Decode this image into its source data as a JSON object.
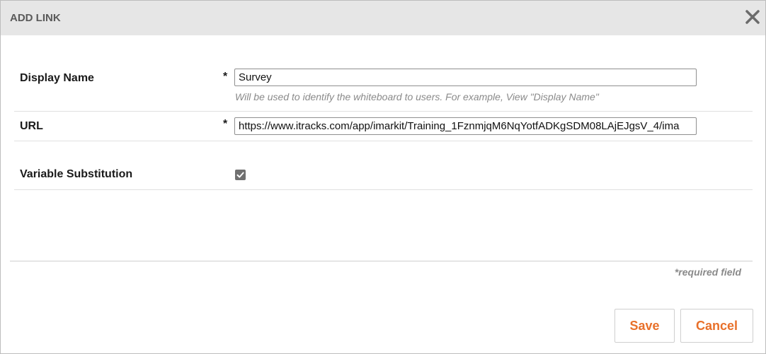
{
  "dialog": {
    "title": "ADD LINK",
    "close_icon": "close-icon"
  },
  "form": {
    "display_name": {
      "label": "Display Name",
      "required_mark": "*",
      "value": "Survey",
      "hint": "Will be used to identify the whiteboard to users. For example, View \"Display Name\""
    },
    "url": {
      "label": "URL",
      "required_mark": "*",
      "value": "https://www.itracks.com/app/imarkit/Training_1FznmjqM6NqYotfADKgSDM08LAjEJgsV_4/ima"
    },
    "variable_substitution": {
      "label": "Variable Substitution",
      "checked": true
    }
  },
  "footer": {
    "required_note": "*required field",
    "save_label": "Save",
    "cancel_label": "Cancel"
  },
  "colors": {
    "accent": "#e8702a",
    "titlebar": "#e6e6e6",
    "checkbox": "#707070"
  }
}
